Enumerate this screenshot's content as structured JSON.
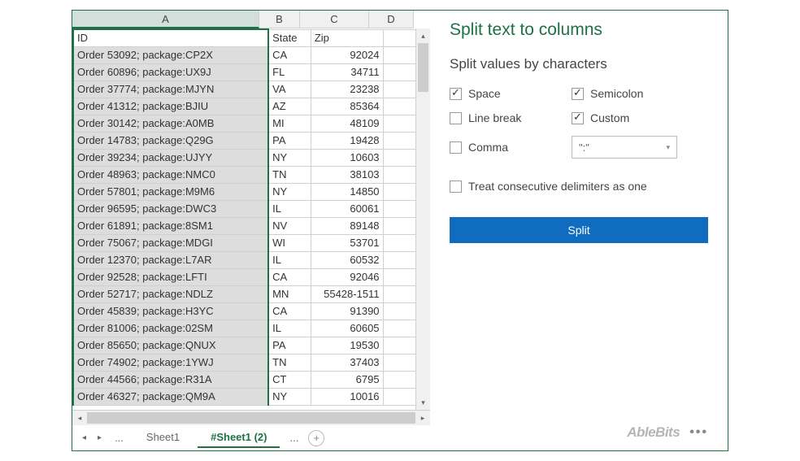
{
  "columns": {
    "a": "A",
    "b": "B",
    "c": "C",
    "d": "D"
  },
  "headers": {
    "id": "ID",
    "state": "State",
    "zip": "Zip"
  },
  "rows": [
    {
      "id": "Order 53092; package:CP2X",
      "state": "CA",
      "zip": "92024"
    },
    {
      "id": "Order 60896; package:UX9J",
      "state": "FL",
      "zip": "34711"
    },
    {
      "id": "Order 37774; package:MJYN",
      "state": "VA",
      "zip": "23238"
    },
    {
      "id": "Order 41312; package:BJIU",
      "state": "AZ",
      "zip": "85364"
    },
    {
      "id": "Order 30142; package:A0MB",
      "state": "MI",
      "zip": "48109"
    },
    {
      "id": "Order 14783; package:Q29G",
      "state": "PA",
      "zip": "19428"
    },
    {
      "id": "Order 39234; package:UJYY",
      "state": "NY",
      "zip": "10603"
    },
    {
      "id": "Order 48963; package:NMC0",
      "state": "TN",
      "zip": "38103"
    },
    {
      "id": "Order 57801; package:M9M6",
      "state": "NY",
      "zip": "14850"
    },
    {
      "id": "Order 96595; package:DWC3",
      "state": "IL",
      "zip": "60061"
    },
    {
      "id": "Order 61891; package:8SM1",
      "state": "NV",
      "zip": "89148"
    },
    {
      "id": "Order 75067; package:MDGI",
      "state": "WI",
      "zip": "53701"
    },
    {
      "id": "Order 12370; package:L7AR",
      "state": "IL",
      "zip": "60532"
    },
    {
      "id": "Order 92528; package:LFTI",
      "state": "CA",
      "zip": "92046"
    },
    {
      "id": "Order 52717; package:NDLZ",
      "state": "MN",
      "zip": "55428-1511"
    },
    {
      "id": "Order 45839; package:H3YC",
      "state": "CA",
      "zip": "91390"
    },
    {
      "id": "Order 81006; package:02SM",
      "state": "IL",
      "zip": "60605"
    },
    {
      "id": "Order 85650; package:QNUX",
      "state": "PA",
      "zip": "19530"
    },
    {
      "id": "Order 74902; package:1YWJ",
      "state": "TN",
      "zip": "37403"
    },
    {
      "id": "Order 44566; package:R31A",
      "state": "CT",
      "zip": "6795"
    },
    {
      "id": "Order 46327; package:QM9A",
      "state": "NY",
      "zip": "10016"
    }
  ],
  "tabs": {
    "sheet1": "Sheet1",
    "sheet1_2": "#Sheet1 (2)"
  },
  "panel": {
    "title": "Split text to columns",
    "subtitle": "Split values by characters",
    "opt_space": "Space",
    "opt_semicolon": "Semicolon",
    "opt_linebreak": "Line break",
    "opt_custom": "Custom",
    "opt_comma": "Comma",
    "custom_value": "\":\"",
    "consecutive": "Treat consecutive delimiters as one",
    "split_btn": "Split"
  },
  "brand": "AbleBits",
  "icons": {
    "plus": "+",
    "dots": "•••",
    "left": "◂",
    "right": "▸",
    "up": "▴",
    "down": "▾",
    "first": "⏮",
    "last": "⏭",
    "caret": "▾"
  }
}
